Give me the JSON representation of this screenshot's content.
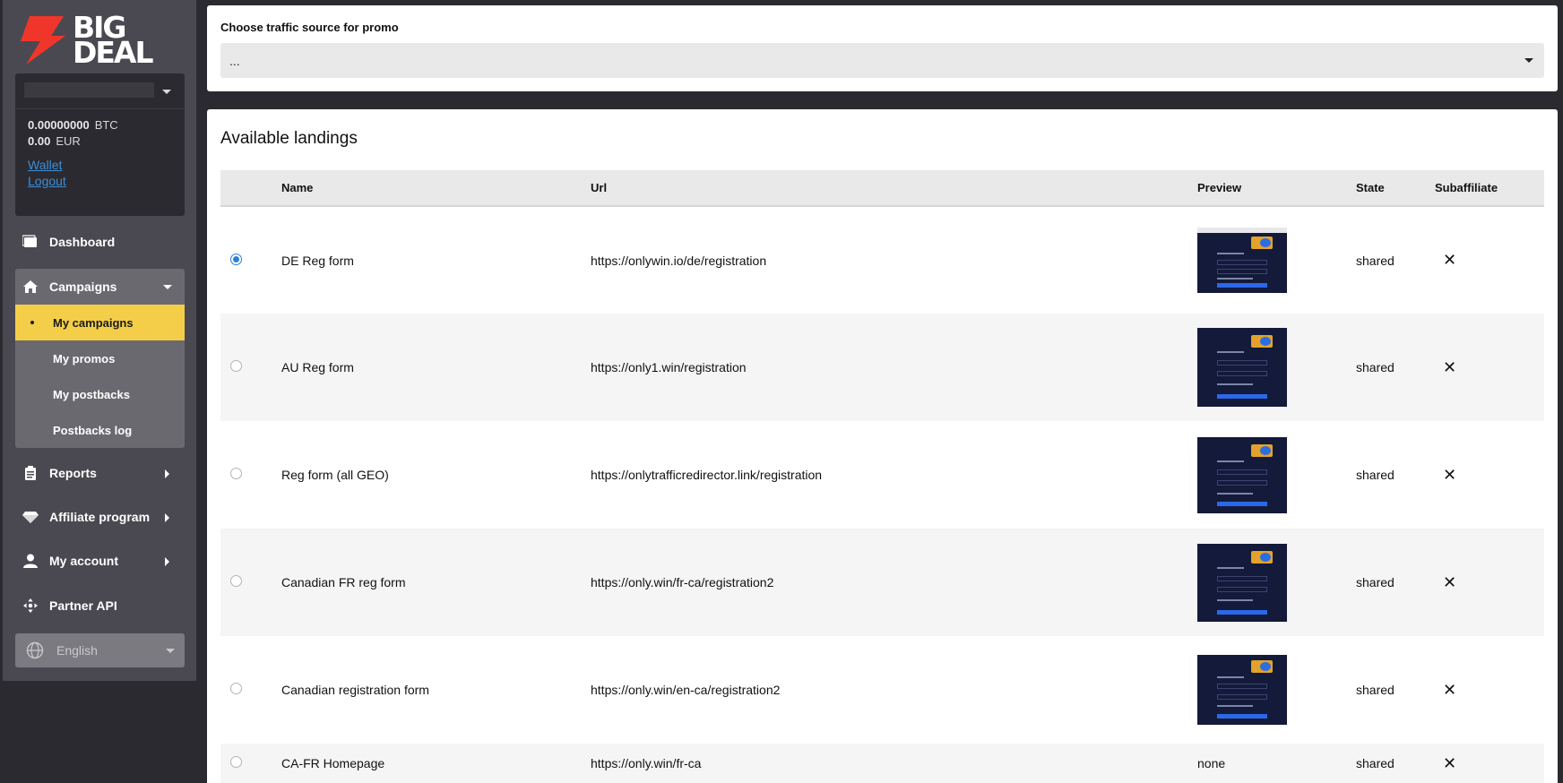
{
  "brand": {
    "logo_line1": "BIG",
    "logo_line2": "DEAL"
  },
  "account": {
    "balances": [
      {
        "amount": "0.00000000",
        "currency": "BTC"
      },
      {
        "amount": "0.00",
        "currency": "EUR"
      }
    ],
    "links": {
      "wallet": "Wallet",
      "logout": "Logout"
    }
  },
  "nav": {
    "dashboard": "Dashboard",
    "campaigns": "Campaigns",
    "campaigns_sub": [
      "My campaigns",
      "My promos",
      "My postbacks",
      "Postbacks log"
    ],
    "reports": "Reports",
    "affiliate": "Affiliate program",
    "my_account": "My account",
    "partner_api": "Partner API"
  },
  "language": {
    "selected": "English"
  },
  "traffic_source": {
    "label": "Choose traffic source for promo",
    "value": "..."
  },
  "landings": {
    "title": "Available landings",
    "columns": [
      "",
      "Name",
      "Url",
      "Preview",
      "State",
      "Subaffiliate"
    ],
    "rows": [
      {
        "selected": true,
        "name": "DE Reg form",
        "url": "https://onlywin.io/de/registration",
        "preview": "image",
        "state": "shared",
        "subaffiliate": "✕"
      },
      {
        "selected": false,
        "name": "AU Reg form",
        "url": "https://only1.win/registration",
        "preview": "image",
        "state": "shared",
        "subaffiliate": "✕"
      },
      {
        "selected": false,
        "name": "Reg form (all GEO)",
        "url": "https://onlytrafficredirector.link/registration",
        "preview": "image",
        "state": "shared",
        "subaffiliate": "✕"
      },
      {
        "selected": false,
        "name": "Canadian FR reg form",
        "url": "https://only.win/fr-ca/registration2",
        "preview": "image",
        "state": "shared",
        "subaffiliate": "✕"
      },
      {
        "selected": false,
        "name": "Canadian registration form",
        "url": "https://only.win/en-ca/registration2",
        "preview": "image",
        "state": "shared",
        "subaffiliate": "✕"
      },
      {
        "selected": false,
        "name": "CA-FR Homepage",
        "url": "https://only.win/fr-ca",
        "preview": "none",
        "state": "shared",
        "subaffiliate": "✕"
      }
    ]
  },
  "colors": {
    "sidebar": "#4a4951",
    "active": "#f4ce49",
    "accent": "#2e7fd6",
    "logo": "#f0362a"
  }
}
